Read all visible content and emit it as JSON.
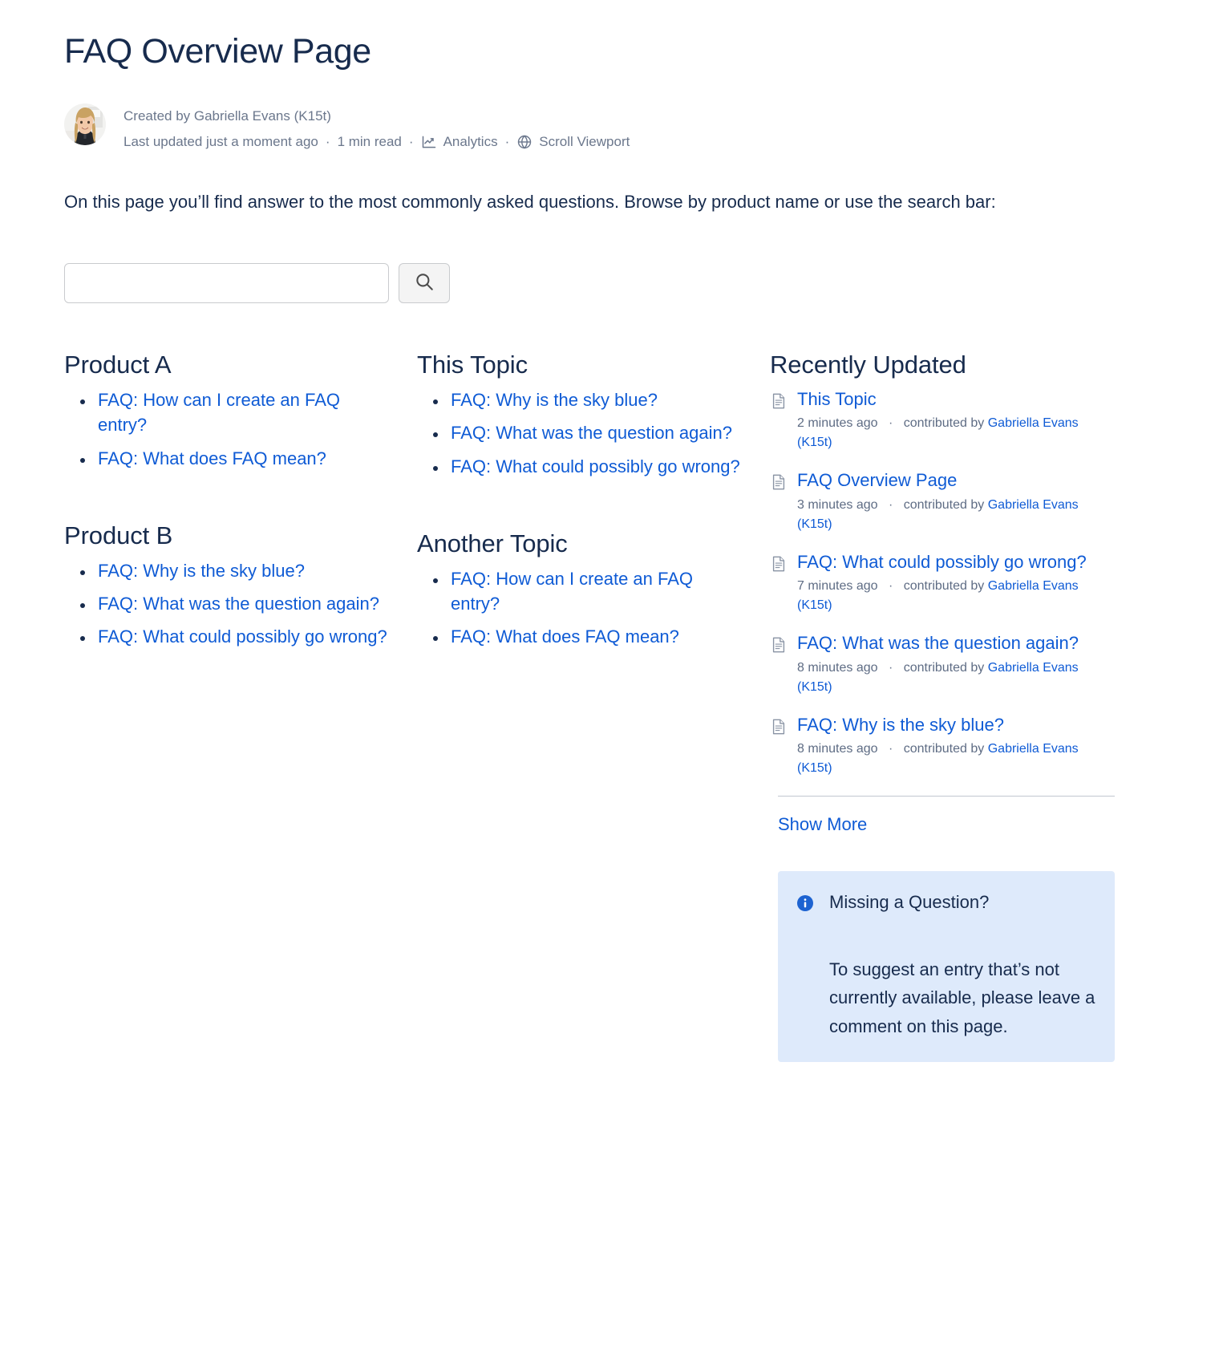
{
  "page": {
    "title": "FAQ Overview Page",
    "intro": "On this page you’ll find answer to the most commonly asked questions. Browse by product name or use the search bar:"
  },
  "byline": {
    "created_by": "Created by Gabriella Evans (K15t)",
    "last_updated": "Last updated just a moment ago",
    "read_time": "1 min read",
    "analytics_label": "Analytics",
    "viewport_label": "Scroll Viewport",
    "separator": "·"
  },
  "search": {
    "value": "",
    "placeholder": "",
    "button_icon": "search-icon"
  },
  "sections": [
    {
      "heading": "Product A",
      "column": 1,
      "items": [
        "FAQ: How can I create an FAQ entry?",
        "FAQ: What does FAQ mean?"
      ]
    },
    {
      "heading": "Product B",
      "column": 1,
      "items": [
        "FAQ: Why is the sky blue?",
        "FAQ: What was the question again?",
        "FAQ: What could possibly go wrong?"
      ]
    },
    {
      "heading": "This Topic",
      "column": 2,
      "items": [
        "FAQ: Why is the sky blue?",
        "FAQ: What was the question again?",
        "FAQ: What could possibly go wrong?"
      ]
    },
    {
      "heading": "Another Topic",
      "column": 2,
      "items": [
        "FAQ: How can I create an FAQ entry?",
        "FAQ: What does FAQ mean?"
      ]
    }
  ],
  "recently_updated": {
    "heading": "Recently Updated",
    "contributed_prefix": "contributed by",
    "separator": "·",
    "items": [
      {
        "title": "This Topic",
        "time": "2 minutes ago",
        "author": "Gabriella Evans (K15t)"
      },
      {
        "title": "FAQ Overview Page",
        "time": "3 minutes ago",
        "author": "Gabriella Evans (K15t)"
      },
      {
        "title": "FAQ: What could possibly go wrong?",
        "time": "7 minutes ago",
        "author": "Gabriella Evans (K15t)"
      },
      {
        "title": "FAQ: What was the question again?",
        "time": "8 minutes ago",
        "author": "Gabriella Evans (K15t)"
      },
      {
        "title": "FAQ: Why is the sky blue?",
        "time": "8 minutes ago",
        "author": "Gabriella Evans (K15t)"
      }
    ],
    "show_more": "Show More"
  },
  "info_panel": {
    "title": "Missing a Question?",
    "body": "To suggest an entry that’s not currently available, please leave a comment on this page."
  },
  "colors": {
    "link": "#0F5BD5",
    "text": "#172B4D",
    "muted": "#6B778C",
    "panel_bg": "#DEEAFB",
    "info_icon": "#1D63D1"
  }
}
